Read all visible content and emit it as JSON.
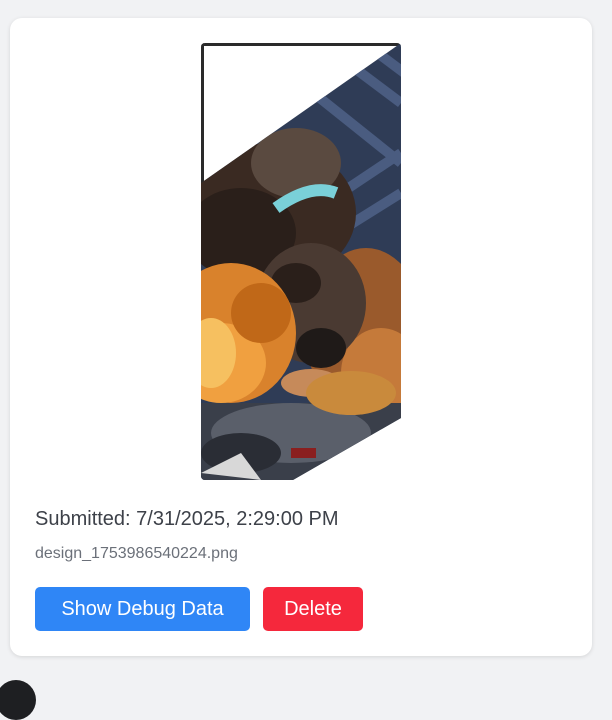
{
  "submission": {
    "submitted_text": "Submitted: 7/31/2025, 2:29:00 PM",
    "filename": "design_1753986540224.png",
    "show_debug_label": "Show Debug Data",
    "delete_label": "Delete"
  },
  "colors": {
    "primary_button": "#2f86f6",
    "danger_button": "#f5283c",
    "card_background": "#ffffff",
    "page_background": "#f1f2f4"
  }
}
